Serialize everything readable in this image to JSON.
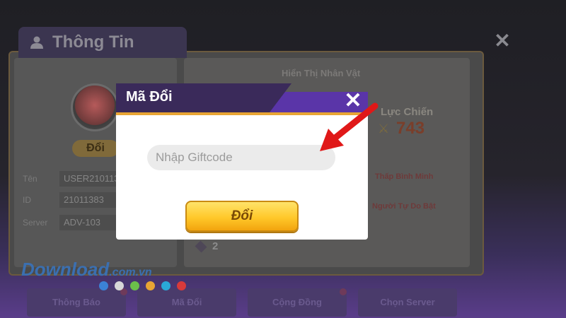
{
  "background": {
    "panel_title": "Thông Tin",
    "hien_thi": "Hiển Thị Nhân Vật",
    "luc_chien_label": "Lực Chiến",
    "luc_chien_value": "743",
    "doi_button": "Đổi",
    "info_rows": [
      {
        "key": "Tên",
        "value": "USER210113"
      },
      {
        "key": "ID",
        "value": "21011383"
      },
      {
        "key": "Server",
        "value": "ADV-103"
      }
    ],
    "red_line_1": "Thấp Bình Minh",
    "red_line_2": "Người Tự Do Bật",
    "gem_count": "2",
    "bottom_buttons": [
      "Thông Báo",
      "Mã Đổi",
      "Cộng Đồng",
      "Chọn Server"
    ]
  },
  "watermark": {
    "text": "Download",
    "suffix": ".com.vn"
  },
  "watermark_dots": [
    "#3b82d6",
    "#d7d7d7",
    "#6bbf4a",
    "#e8a534",
    "#2aa8d8",
    "#d83a3a"
  ],
  "dialog": {
    "title": "Mã Đổi",
    "input_placeholder": "Nhập Giftcode",
    "redeem_label": "Đổi"
  },
  "colors": {
    "header": "#3a2a5a",
    "band": "#5a35a8",
    "stripe": "#e8a534",
    "arrow": "#e01818"
  }
}
